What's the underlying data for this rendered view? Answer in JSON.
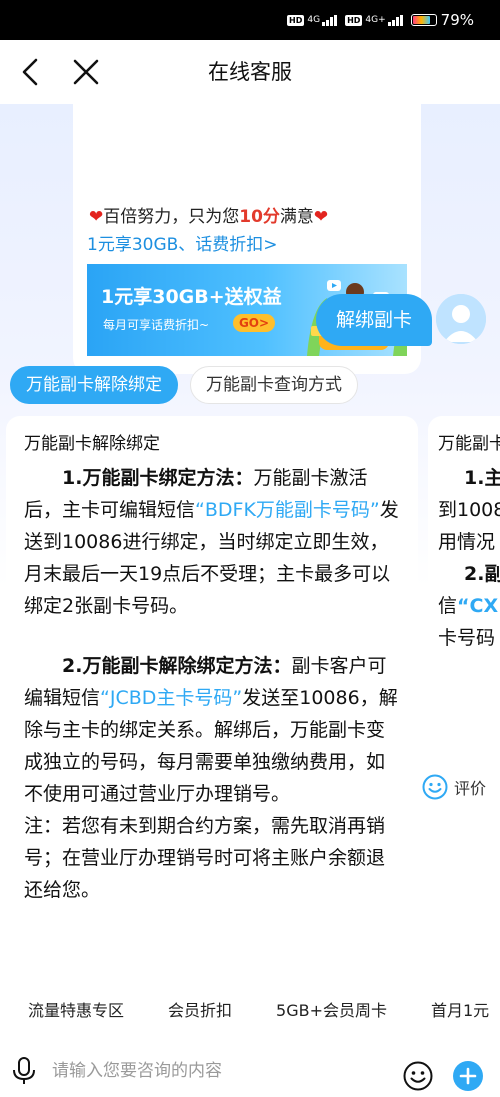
{
  "status_bar": {
    "hd1": "HD",
    "net1": "4G",
    "hd2": "HD",
    "net2": "4G+",
    "battery_percent": "79%",
    "battery_level": 0.79
  },
  "header": {
    "title": "在线客服"
  },
  "promo": {
    "line1_prefix": "百倍努力，只为您",
    "line1_highlight": "10分",
    "line1_suffix": "满意",
    "link": "1元享30GB、话费折扣>",
    "banner_title": "1元享30GB+送权益",
    "banner_sub": "每月可享话费折扣~",
    "banner_button": "GO>"
  },
  "user_message": "解绑副卡",
  "chips": [
    {
      "label": "万能副卡解除绑定",
      "active": true
    },
    {
      "label": "万能副卡查询方式",
      "active": false
    }
  ],
  "answer": {
    "title": "万能副卡解除绑定",
    "p1_bold": "1.万能副卡绑定方法：",
    "p1_a": "万能副卡激活后，主卡可编辑短信",
    "p1_code": "“BDFK万能副卡号码”",
    "p1_b": "发送到10086进行绑定，当时绑定立即生效，月末最后一天19点后不受理；主卡最多可以绑定2张副卡号码。",
    "p2_bold": "2.万能副卡解除绑定方法：",
    "p2_a": "副卡客户可编辑短信",
    "p2_code": "“JCBD主卡号码”",
    "p2_b": "发送至10086，解除与主卡的绑定关系。解绑后，万能副卡变成独立的号码，每月需要单独缴纳费用，如不使用可通过营业厅办理销号。",
    "note": "注：若您有未到期合约方案，需先取消再销号；在营业厅办理销号时可将主账户余额退还给您。"
  },
  "peek": {
    "title": "万能副卡",
    "l1": "1.主",
    "l2": "到1008",
    "l3": "用情况",
    "l4": "2.副",
    "l5_a": "信",
    "l5_code": "“CX",
    "l6": "卡号码"
  },
  "rate_label": "评价",
  "quick_menu": [
    "流量特惠专区",
    "会员折扣",
    "5GB+会员周卡",
    "首月1元"
  ],
  "input": {
    "placeholder": "请输入您要咨询的内容"
  },
  "colors": {
    "accent": "#2fa9f4",
    "highlight_red": "#e23a2c",
    "link_blue": "#1d8fe0"
  }
}
